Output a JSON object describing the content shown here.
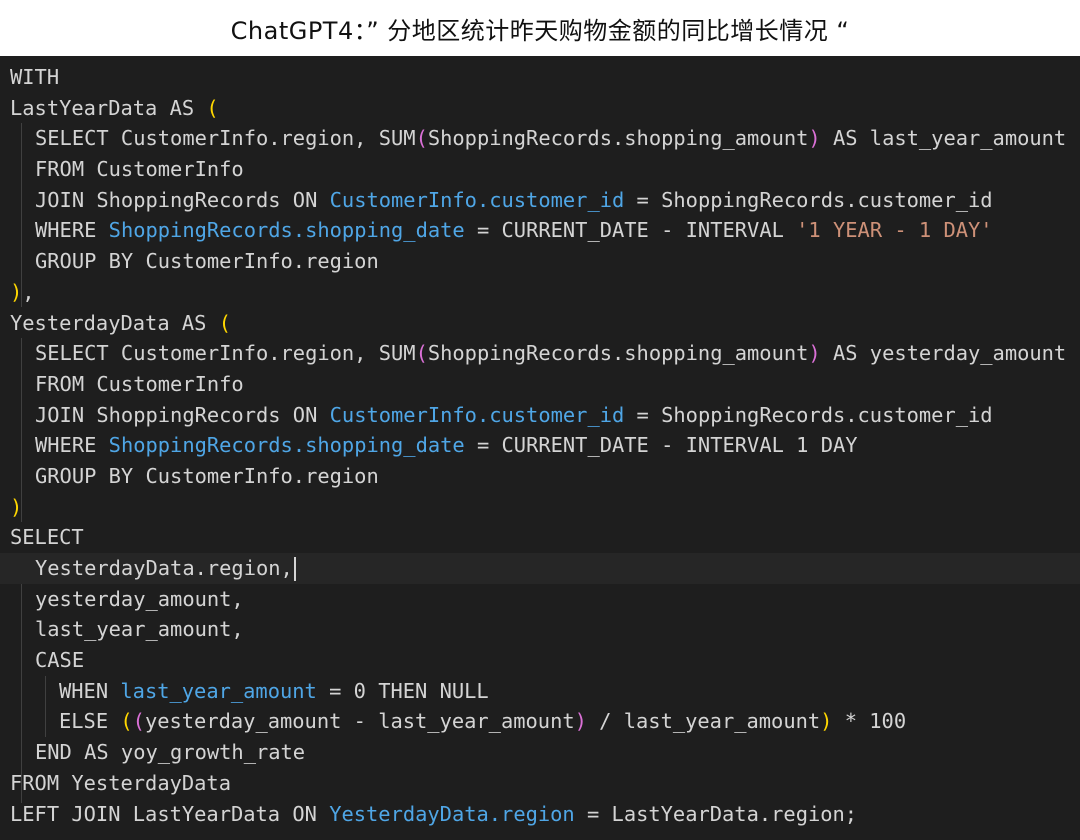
{
  "caption": "ChatGPT4：”  分地区统计昨天购物金额的同比增长情况 “",
  "code": {
    "l1": [
      "WITH"
    ],
    "l2": [
      "LastYearData AS ",
      "("
    ],
    "l3": [
      "SELECT CustomerInfo.region, SUM",
      "(",
      "ShoppingRecords.shopping_amount",
      ")",
      " AS last_year_amount"
    ],
    "l4": [
      "FROM CustomerInfo"
    ],
    "l5": [
      "JOIN ShoppingRecords ON ",
      "CustomerInfo.customer_id",
      " = ShoppingRecords.customer_id"
    ],
    "l6": [
      "WHERE ",
      "ShoppingRecords.shopping_date",
      " = CURRENT_DATE - INTERVAL ",
      "'1 YEAR - 1 DAY'"
    ],
    "l7": [
      "GROUP BY CustomerInfo.region"
    ],
    "l8": [
      ")",
      ","
    ],
    "l9": [
      "YesterdayData AS ",
      "("
    ],
    "l10": [
      "SELECT CustomerInfo.region, SUM",
      "(",
      "ShoppingRecords.shopping_amount",
      ")",
      " AS yesterday_amount"
    ],
    "l11": [
      "FROM CustomerInfo"
    ],
    "l12": [
      "JOIN ShoppingRecords ON ",
      "CustomerInfo.customer_id",
      " = ShoppingRecords.customer_id"
    ],
    "l13": [
      "WHERE ",
      "ShoppingRecords.shopping_date",
      " = CURRENT_DATE - INTERVAL 1 DAY"
    ],
    "l14": [
      "GROUP BY CustomerInfo.region"
    ],
    "l15": [
      ")"
    ],
    "l16": [
      "SELECT"
    ],
    "l17": [
      "YesterdayData.region,"
    ],
    "l18": [
      "yesterday_amount,"
    ],
    "l19": [
      "last_year_amount,"
    ],
    "l20": [
      "CASE"
    ],
    "l21": [
      "WHEN ",
      "last_year_amount",
      " = 0 THEN NULL"
    ],
    "l22": [
      "ELSE ",
      "(",
      "(",
      "yesterday_amount - last_year_amount",
      ")",
      " / last_year_amount",
      ")",
      " * 100"
    ],
    "l23": [
      "END AS yoy_growth_rate"
    ],
    "l24": [
      "FROM YesterdayData"
    ],
    "l25": [
      "LEFT JOIN LastYearData ON ",
      "YesterdayData.region",
      " = LastYearData.region;"
    ]
  },
  "colors": {
    "background": "#1e1e1e",
    "text": "#d4d4d4",
    "identifier_blue": "#4fa6e6",
    "string": "#ce9178",
    "bracket_level1": "#ffd700",
    "bracket_level2": "#da70d6"
  }
}
